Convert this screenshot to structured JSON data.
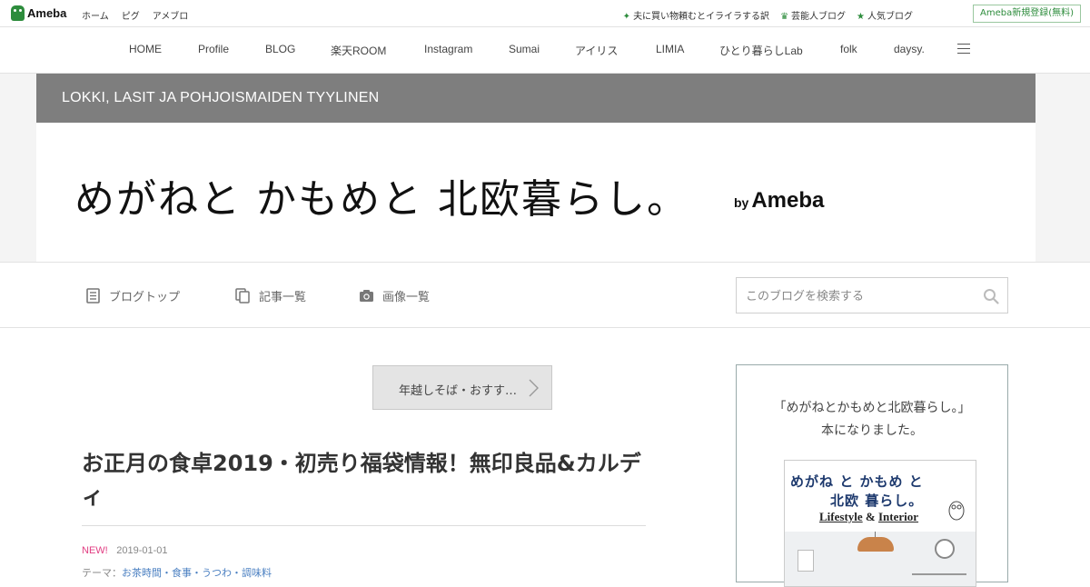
{
  "topbar": {
    "logo": "Ameba",
    "links": [
      "ホーム",
      "ピグ",
      "アメブロ"
    ],
    "right_links": [
      {
        "icon": "sparkle-icon",
        "label": "夫に買い物頼むとイライラする訳"
      },
      {
        "icon": "crown-icon",
        "label": "芸能人ブログ"
      },
      {
        "icon": "star-icon",
        "label": "人気ブログ"
      }
    ],
    "signup": "Ameba新規登録(無料)"
  },
  "nav": {
    "items": [
      "HOME",
      "Profile",
      "BLOG",
      "楽天ROOM",
      "Instagram",
      "Sumai",
      "アイリス",
      "LIMIA",
      "ひとり暮らしLab",
      "folk",
      "daysy."
    ]
  },
  "header": {
    "subtitle": "LOKKI, LASIT JA POHJOISMAIDEN TYYLINEN",
    "title": "めがねと かもめと 北欧暮らし。",
    "by": "by",
    "brand": "Ameba"
  },
  "subnav": {
    "blog_top": "ブログトップ",
    "article_list": "記事一覧",
    "image_list": "画像一覧",
    "search_placeholder": "このブログを検索する"
  },
  "main": {
    "prev_button": "年越しそば・おすす…",
    "article_title": "お正月の食卓2019・初売り福袋情報！無印良品&カルディ",
    "new_badge": "NEW!",
    "date": "2019-01-01",
    "theme_label": "テーマ：",
    "themes": "お茶時間・食事・うつわ・調味料"
  },
  "sidebar": {
    "line1": "「めがねとかもめと北欧暮らし。」",
    "line2": "本になりました。",
    "book": {
      "title_line1": "めがね と かもめ と",
      "title_line2": "北欧 暮らし。",
      "lifestyle": "Lifestyle",
      "amp": "&",
      "interior": "Interior"
    }
  },
  "colors": {
    "ameba_green": "#2d8c3c",
    "header_band": "#7e7e7e",
    "new_pink": "#e13d82",
    "link_blue": "#4a7fc1",
    "book_navy": "#1e3a6e"
  }
}
